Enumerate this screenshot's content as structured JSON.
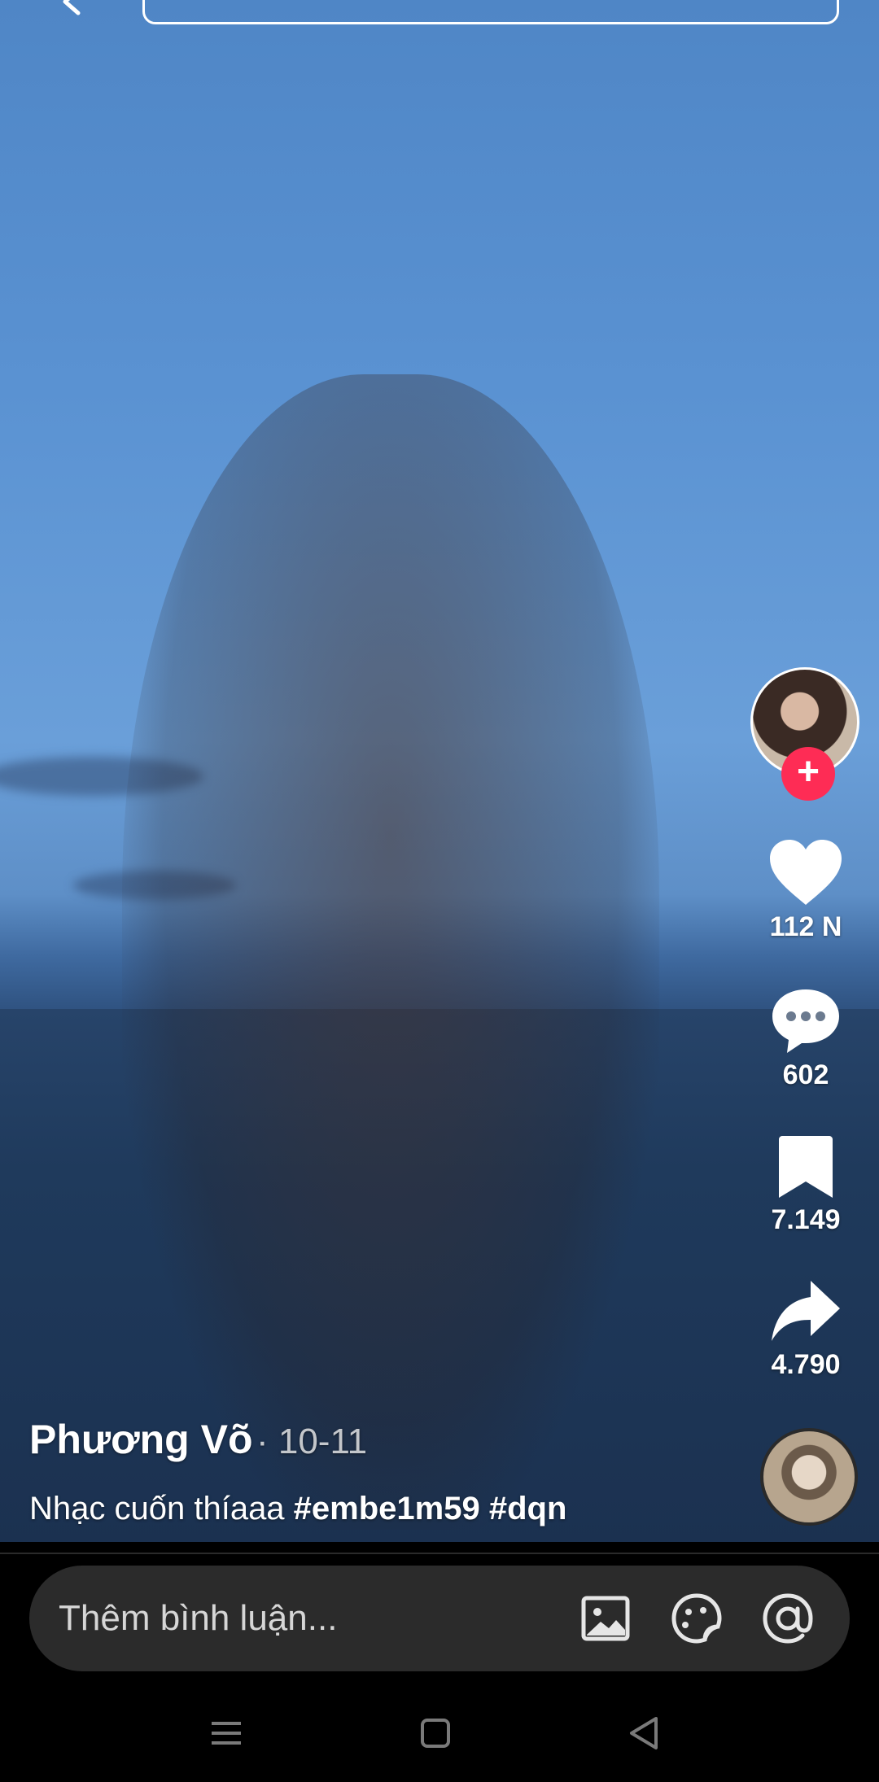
{
  "post": {
    "author": "Phương Võ",
    "date": "· 10-11",
    "caption_text": "Nhạc cuốn thíaaa ",
    "hashtags": [
      "#embe1m59",
      "#dqn"
    ]
  },
  "actions": {
    "likes": "112 N",
    "comments": "602",
    "saves": "7.149",
    "shares": "4.790"
  },
  "comment_bar": {
    "placeholder": "Thêm bình luận..."
  },
  "colors": {
    "follow_accent": "#fe2c55",
    "comment_bar_bg": "#2b2b2b",
    "background": "#000000"
  },
  "icons": {
    "back": "back-arrow-icon",
    "like": "heart-icon",
    "comment": "comment-bubble-icon",
    "save": "bookmark-icon",
    "share": "share-arrow-icon",
    "image": "image-icon",
    "sticker": "sticker-icon",
    "mention": "at-sign-icon",
    "nav_menu": "menu-icon",
    "nav_home": "home-square-icon",
    "nav_back": "back-triangle-icon"
  }
}
